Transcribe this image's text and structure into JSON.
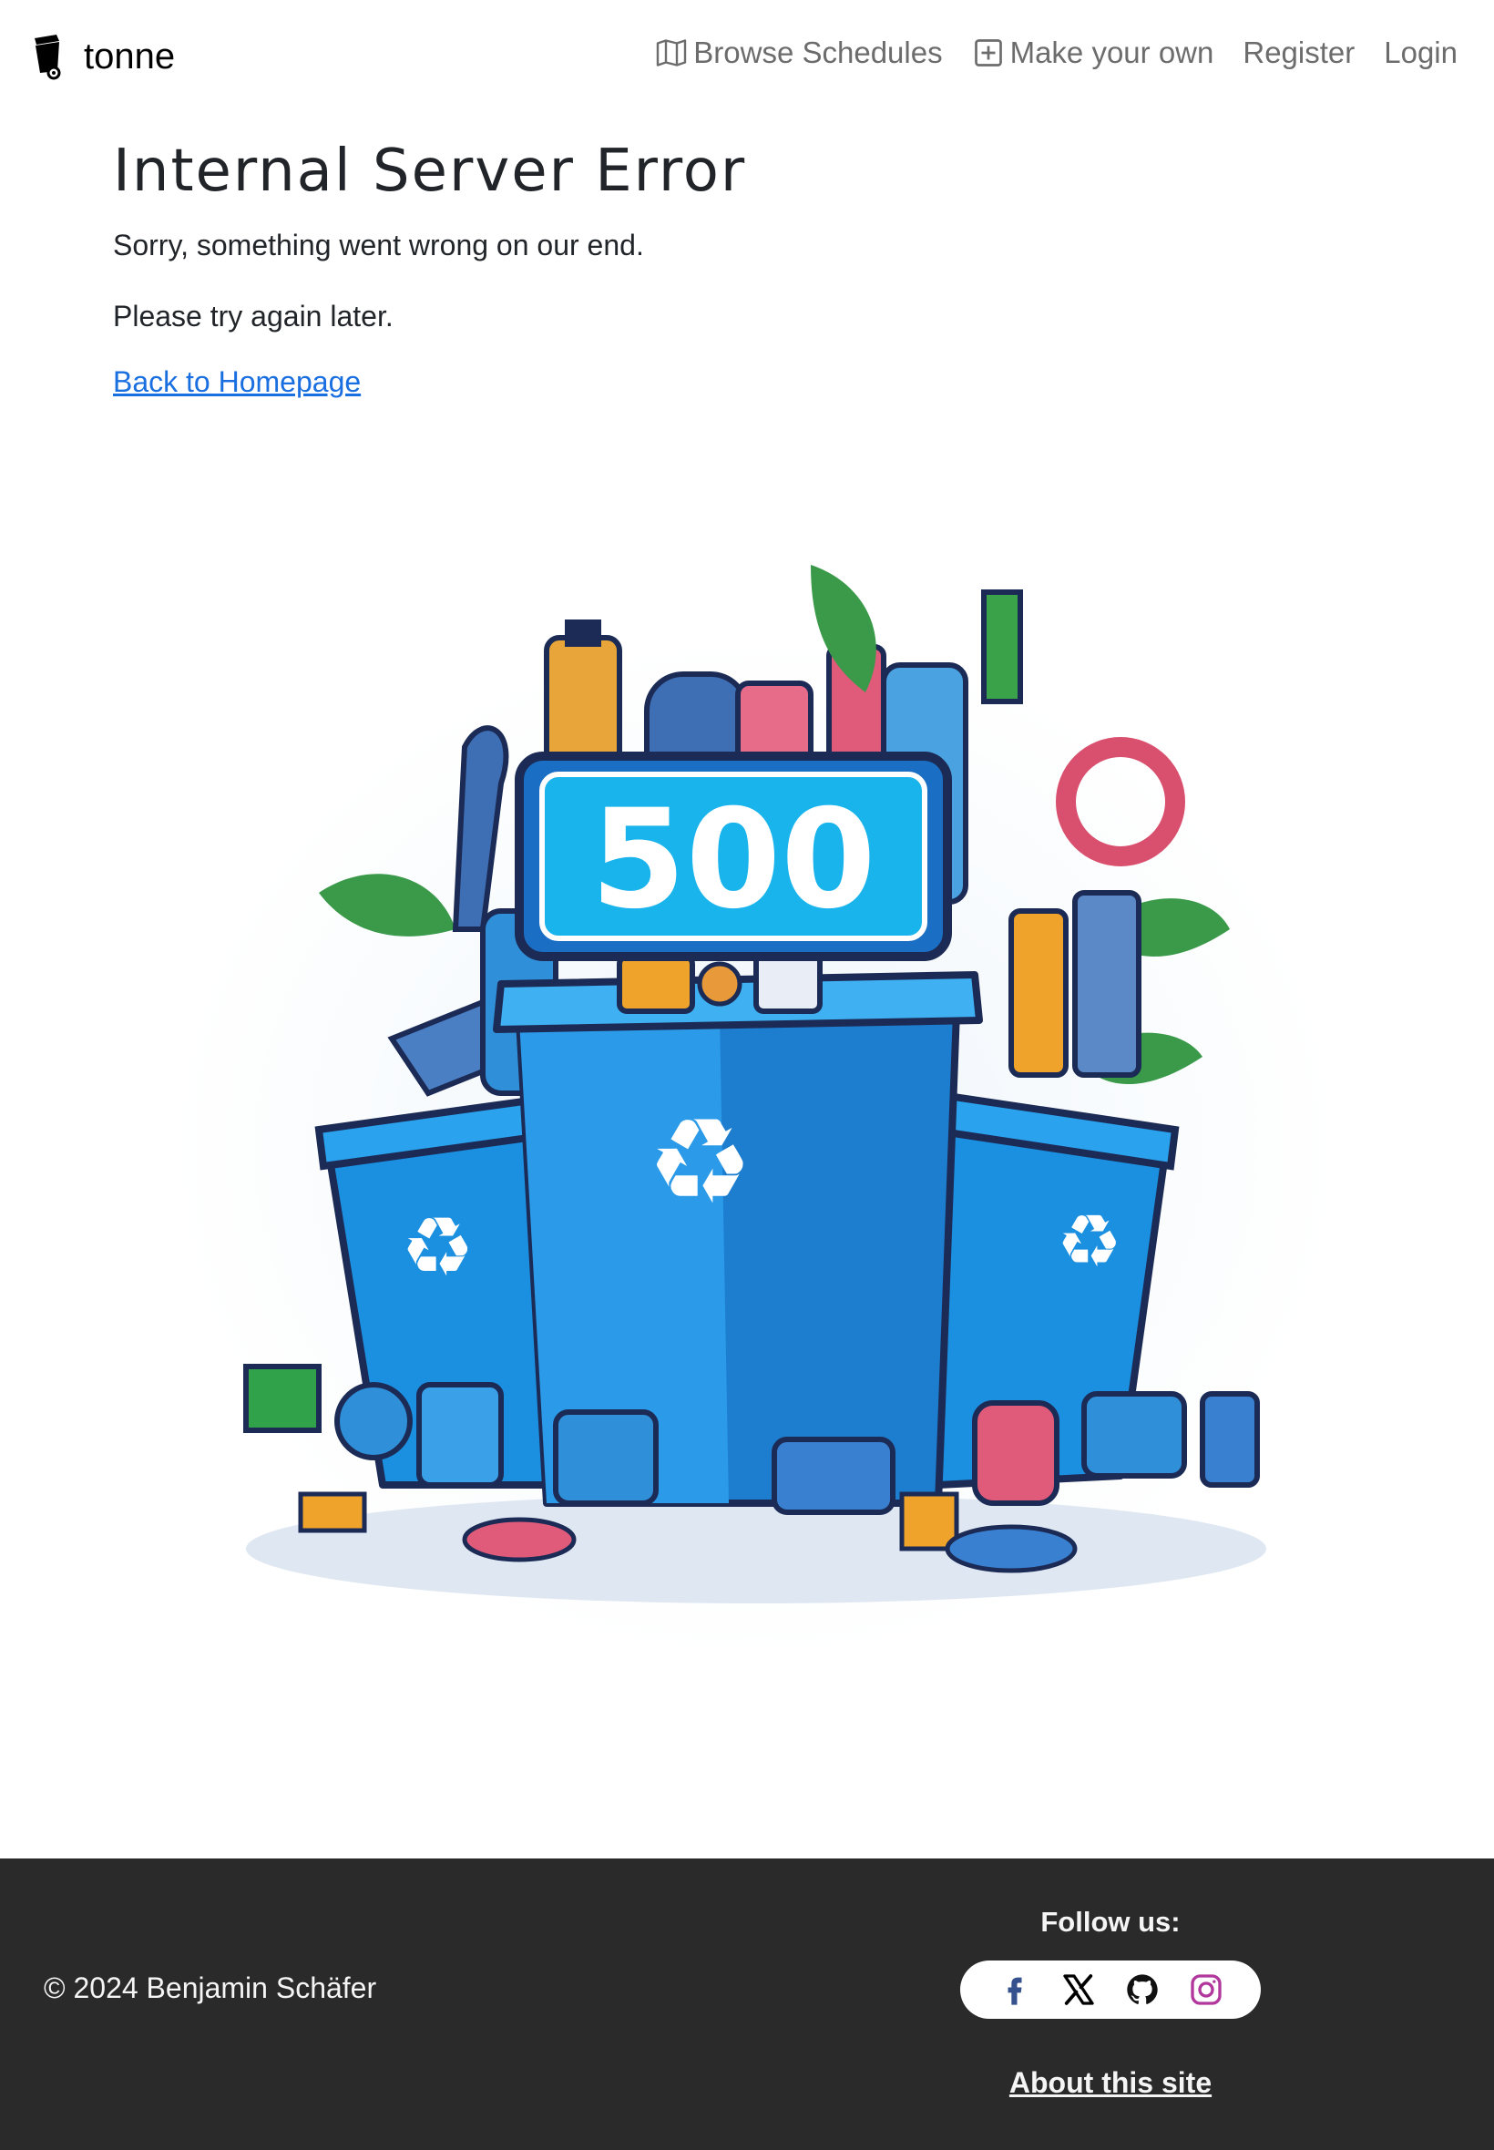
{
  "brand": {
    "name": "tonne",
    "icon": "trash-bin-icon"
  },
  "nav": {
    "browse_label": "Browse Schedules",
    "browse_icon": "map-icon",
    "make_label": "Make your own",
    "make_icon": "plus-square-icon",
    "register_label": "Register",
    "login_label": "Login"
  },
  "main": {
    "title": "Internal Server Error",
    "message": "Sorry, something went wrong on our end.",
    "retry": "Please try again later.",
    "home_link": "Back to Homepage"
  },
  "illustration": {
    "sign_text": "500"
  },
  "footer": {
    "copyright": "© 2024 Benjamin Schäfer",
    "follow_title": "Follow us:",
    "social": [
      "facebook-icon",
      "x-twitter-icon",
      "github-icon",
      "instagram-icon"
    ],
    "about_link": "About this site"
  },
  "colors": {
    "link": "#1a6fe0",
    "footer_bg": "#2a2a2a",
    "nav_text": "#6c6c6c",
    "bin_blue": "#1b8fe0",
    "sign_blue": "#19b4ec",
    "instagram": "#b1379c",
    "facebook": "#35528f"
  }
}
